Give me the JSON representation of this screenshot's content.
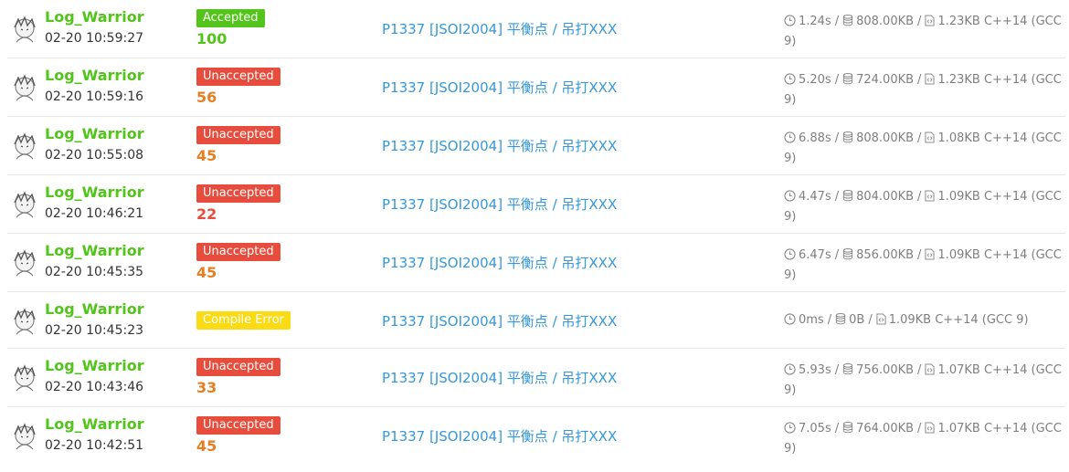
{
  "colors": {
    "username": "#52c41a",
    "accepted": "#52c41a",
    "unaccepted": "#e74c3c",
    "compile_error": "#fadb14",
    "score_full": "#52c41a",
    "score_mid": "#e67e22",
    "score_low": "#e74c3c",
    "link": "#3498db"
  },
  "icons": {
    "time": "clock-icon",
    "memory": "database-icon",
    "code": "file-code-icon"
  },
  "records": [
    {
      "user": "Log_Warrior",
      "time": "02-20 10:59:27",
      "status": "Accepted",
      "status_type": "accepted",
      "score": "100",
      "score_color": "#52c41a",
      "problem": "P1337 [JSOI2004] 平衡点 / 吊打XXX",
      "run_time": "1.24s",
      "memory": "808.00KB",
      "code_size": "1.23KB",
      "lang": "C++14 (GCC 9)"
    },
    {
      "user": "Log_Warrior",
      "time": "02-20 10:59:16",
      "status": "Unaccepted",
      "status_type": "unaccepted",
      "score": "56",
      "score_color": "#e67e22",
      "problem": "P1337 [JSOI2004] 平衡点 / 吊打XXX",
      "run_time": "5.20s",
      "memory": "724.00KB",
      "code_size": "1.23KB",
      "lang": "C++14 (GCC 9)"
    },
    {
      "user": "Log_Warrior",
      "time": "02-20 10:55:08",
      "status": "Unaccepted",
      "status_type": "unaccepted",
      "score": "45",
      "score_color": "#e67e22",
      "problem": "P1337 [JSOI2004] 平衡点 / 吊打XXX",
      "run_time": "6.88s",
      "memory": "808.00KB",
      "code_size": "1.08KB",
      "lang": "C++14 (GCC 9)"
    },
    {
      "user": "Log_Warrior",
      "time": "02-20 10:46:21",
      "status": "Unaccepted",
      "status_type": "unaccepted",
      "score": "22",
      "score_color": "#e74c3c",
      "problem": "P1337 [JSOI2004] 平衡点 / 吊打XXX",
      "run_time": "4.47s",
      "memory": "804.00KB",
      "code_size": "1.09KB",
      "lang": "C++14 (GCC 9)"
    },
    {
      "user": "Log_Warrior",
      "time": "02-20 10:45:35",
      "status": "Unaccepted",
      "status_type": "unaccepted",
      "score": "45",
      "score_color": "#e67e22",
      "problem": "P1337 [JSOI2004] 平衡点 / 吊打XXX",
      "run_time": "6.47s",
      "memory": "856.00KB",
      "code_size": "1.09KB",
      "lang": "C++14 (GCC 9)"
    },
    {
      "user": "Log_Warrior",
      "time": "02-20 10:45:23",
      "status": "Compile Error",
      "status_type": "compile",
      "score": "",
      "score_color": "#e67e22",
      "problem": "P1337 [JSOI2004] 平衡点 / 吊打XXX",
      "run_time": "0ms",
      "memory": "0B",
      "code_size": "1.09KB",
      "lang": "C++14 (GCC 9)"
    },
    {
      "user": "Log_Warrior",
      "time": "02-20 10:43:46",
      "status": "Unaccepted",
      "status_type": "unaccepted",
      "score": "33",
      "score_color": "#e67e22",
      "problem": "P1337 [JSOI2004] 平衡点 / 吊打XXX",
      "run_time": "5.93s",
      "memory": "756.00KB",
      "code_size": "1.07KB",
      "lang": "C++14 (GCC 9)"
    },
    {
      "user": "Log_Warrior",
      "time": "02-20 10:42:51",
      "status": "Unaccepted",
      "status_type": "unaccepted",
      "score": "45",
      "score_color": "#e67e22",
      "problem": "P1337 [JSOI2004] 平衡点 / 吊打XXX",
      "run_time": "7.05s",
      "memory": "764.00KB",
      "code_size": "1.07KB",
      "lang": "C++14 (GCC 9)"
    }
  ]
}
